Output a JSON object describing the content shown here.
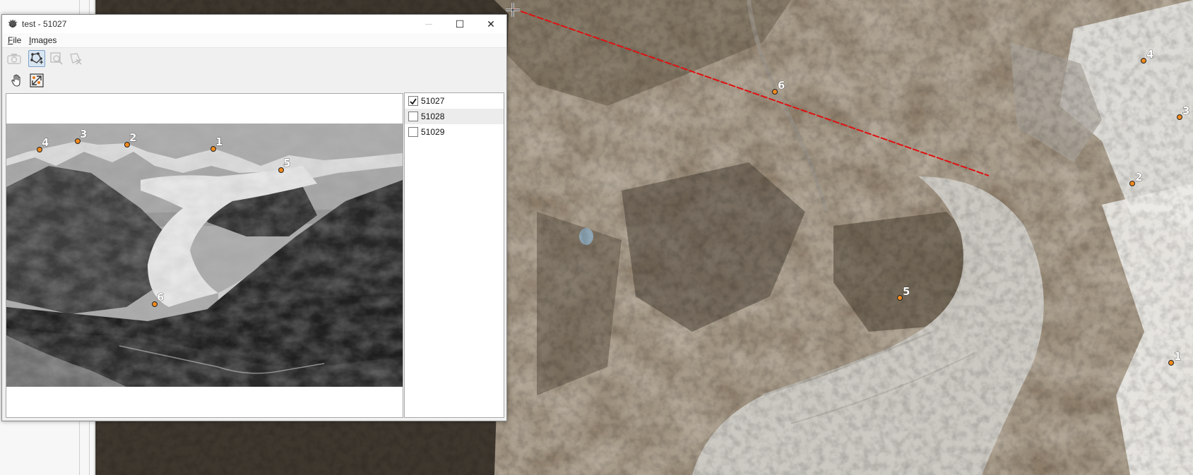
{
  "window": {
    "title": "test - 51027",
    "minimize_label": "—",
    "maximize_label": "☐",
    "close_label": "✕"
  },
  "menu": [
    {
      "mnemonic": "F",
      "rest": "ile"
    },
    {
      "mnemonic": "I",
      "rest": "mages"
    }
  ],
  "toolbar": {
    "row1": [
      "camera-icon",
      "add-tiepoint-icon",
      "zoom-selection-icon",
      "delete-tiepoint-icon"
    ],
    "row2": [
      "pan-hand-icon",
      "fit-view-icon"
    ],
    "active_tool": "add-tiepoint-icon"
  },
  "image_list": [
    {
      "label": "51027",
      "checked": true
    },
    {
      "label": "51028",
      "checked": false
    },
    {
      "label": "51029",
      "checked": false
    }
  ],
  "photo_points": [
    "1",
    "2",
    "3",
    "4",
    "5",
    "6"
  ],
  "map_points": [
    "1",
    "2",
    "3",
    "4",
    "5",
    "6"
  ],
  "colors": {
    "point_fill": "#f08a1e",
    "ray_line": "#e01010",
    "selected_row": "#ececec"
  }
}
